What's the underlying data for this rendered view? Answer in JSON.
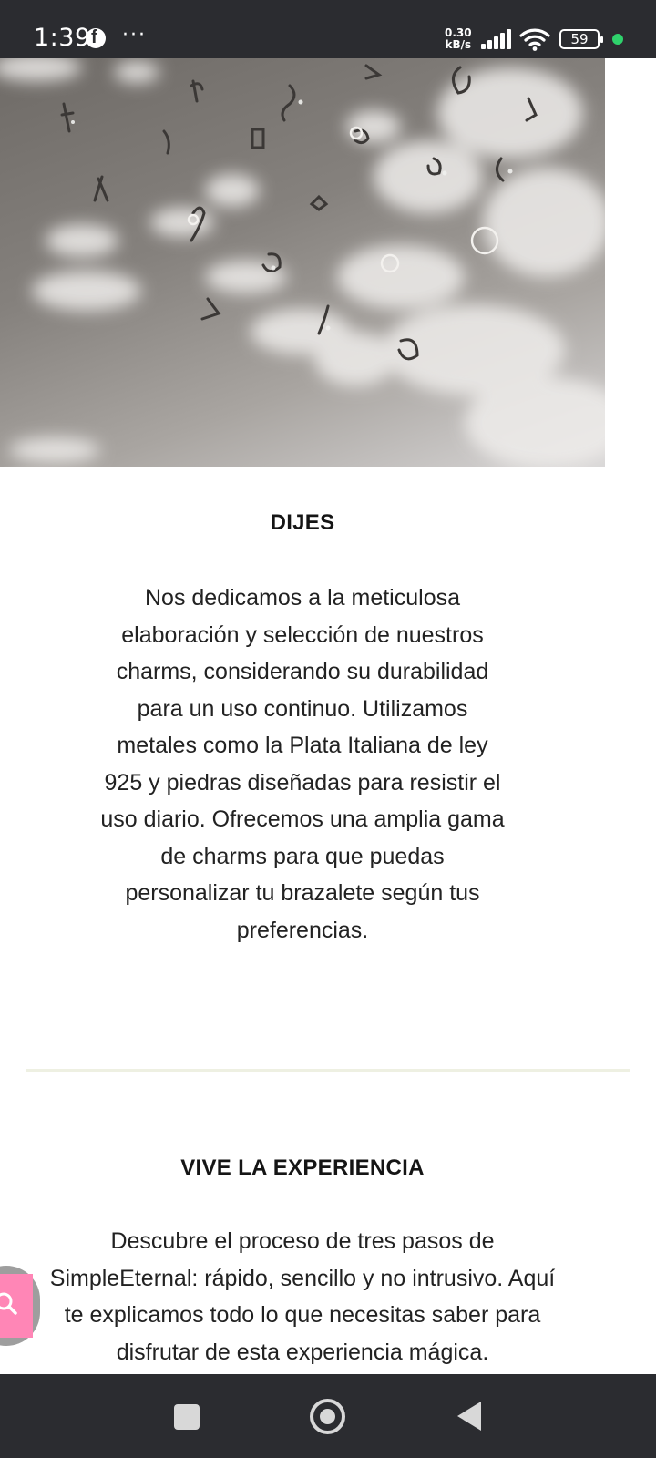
{
  "status_bar": {
    "time": "1:39",
    "more": "···",
    "speed_value": "0.30",
    "speed_unit": "kB/s",
    "battery": "59",
    "icons": [
      "facebook-icon",
      "signal-icon",
      "wifi-icon",
      "battery-icon",
      "active-dot-icon"
    ],
    "accent_dot_color": "#2fd26c"
  },
  "hero": {
    "description_icon": "charms-photo"
  },
  "section_dijes": {
    "title": "DIJES",
    "lines": [
      "Nos dedicamos a la meticulosa",
      "elaboración y selección de nuestros",
      "charms, considerando su durabilidad",
      "para un uso continuo. Utilizamos",
      "metales como la Plata Italiana de ley",
      "925 y piedras diseñadas para resistir el",
      "uso diario. Ofrecemos una amplia gama",
      "de charms para que puedas",
      "personalizar tu brazalete según tus",
      "preferencias."
    ]
  },
  "section_experiencia": {
    "title": "VIVE LA EXPERIENCIA",
    "lines": [
      "Descubre el proceso de tres pasos de",
      "SimpleEternal: rápido, sencillo y no intrusivo. Aquí",
      "te explicamos todo lo que necesitas saber para",
      "disfrutar de esta experiencia mágica."
    ]
  },
  "search_fab": {
    "icon": "search-icon",
    "color": "#ff86b6"
  },
  "nav_bar": {
    "icons": [
      "recents-icon",
      "home-icon",
      "back-icon"
    ]
  }
}
